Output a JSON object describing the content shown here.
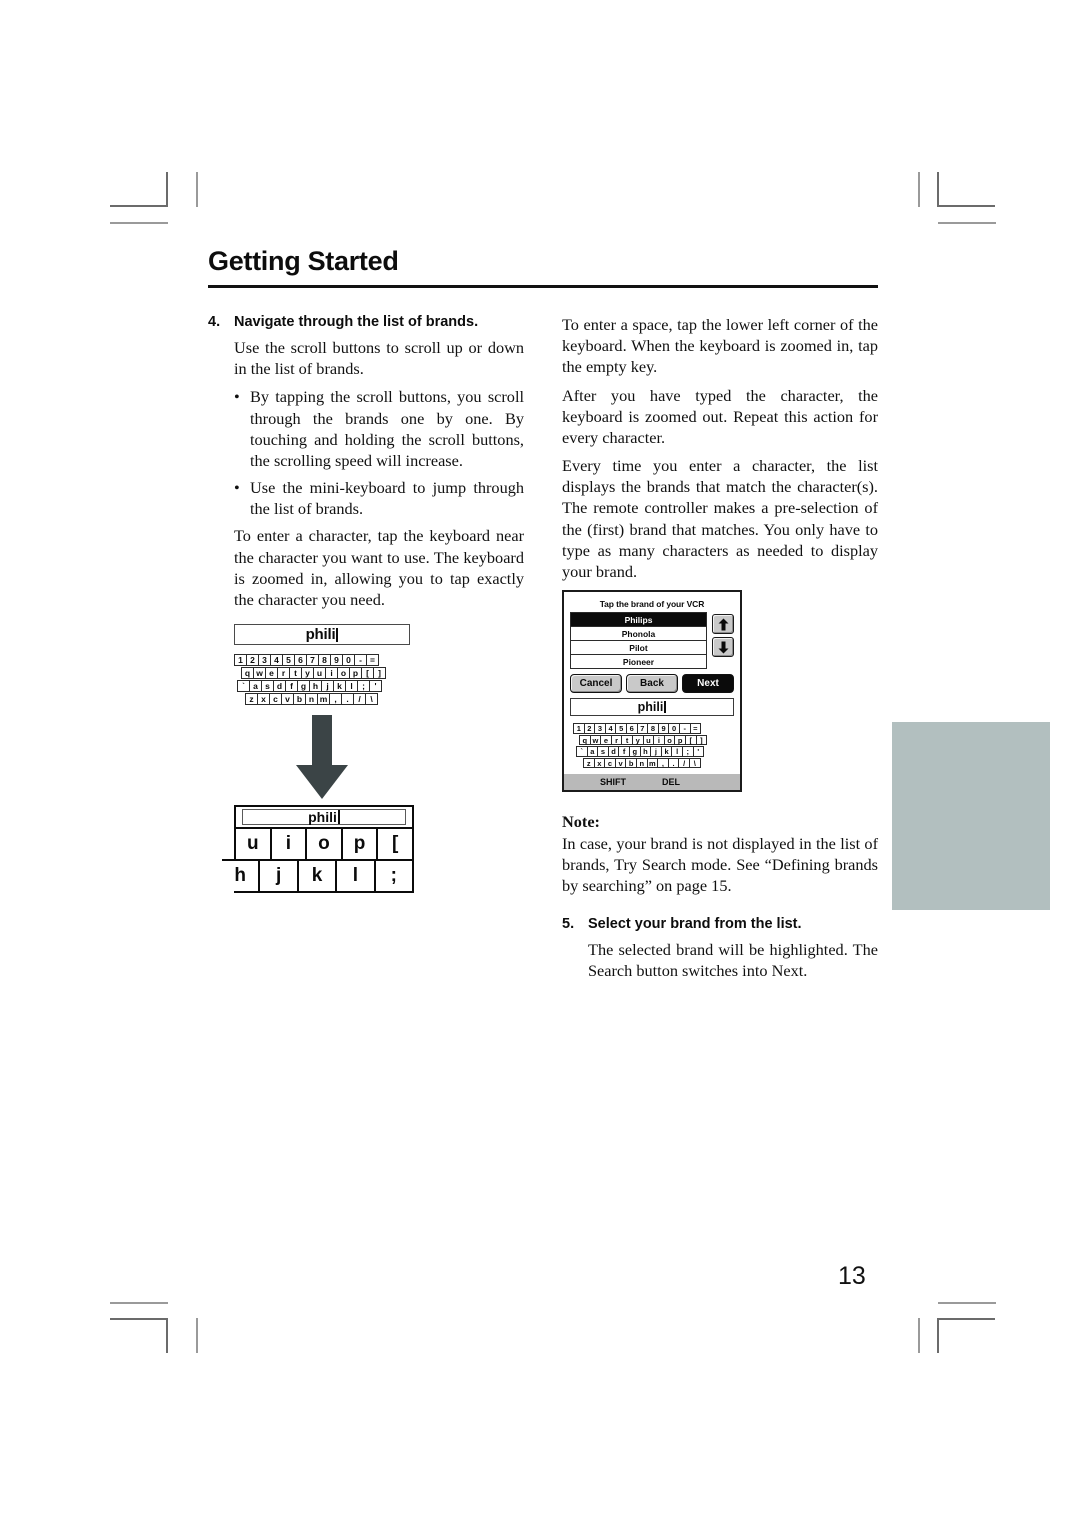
{
  "document": {
    "header_title": "Getting Started",
    "page_number": "13"
  },
  "left_column": {
    "step": {
      "number": "4.",
      "title": "Navigate through the list of brands."
    },
    "intro": "Use the scroll buttons to scroll up or down in the list of brands.",
    "bullet_marker": "•",
    "bullets": [
      "By tapping the scroll buttons, you scroll through the brands one by one. By touching and holding the scroll buttons, the scrolling speed will increase.",
      "Use the mini-keyboard to jump through the list of brands."
    ],
    "closing": "To enter a character, tap the keyboard near the character you want to use. The keyboard is zoomed in, allowing you to tap exactly the character you need."
  },
  "right_column": {
    "paragraphs": [
      "To enter a space, tap the lower left corner of the keyboard. When the keyboard is zoomed in, tap the empty key.",
      "After you have typed the character, the keyboard is zoomed out. Repeat this action for every character.",
      "Every time you enter a character, the list displays the brands that match the character(s). The remote controller makes a pre-selection of the (first) brand that matches. You only have to type as many characters as needed to display your brand."
    ],
    "note": {
      "label": "Note:",
      "text": "In case, your brand is not displayed in the list of brands, Try Search mode. See “Defining brands by searching” on page 15."
    },
    "step": {
      "number": "5.",
      "title": "Select your brand from the list."
    },
    "step_body": "The selected brand will be highlighted. The Search button switches into Next."
  },
  "figure_keyboard": {
    "input_value": "phili",
    "rows": [
      {
        "indent": 0,
        "keys": [
          "1",
          "2",
          "3",
          "4",
          "5",
          "6",
          "7",
          "8",
          "9",
          "0",
          "-",
          "="
        ]
      },
      {
        "indent": 7,
        "keys": [
          "q",
          "w",
          "e",
          "r",
          "t",
          "y",
          "u",
          "i",
          "o",
          "p",
          "[",
          "]"
        ]
      },
      {
        "indent": 3,
        "keys": [
          "`",
          "a",
          "s",
          "d",
          "f",
          "g",
          "h",
          "j",
          "k",
          "l",
          ";",
          "'"
        ]
      },
      {
        "indent": 11,
        "keys": [
          "z",
          "x",
          "c",
          "v",
          "b",
          "n",
          "m",
          ",",
          ".",
          "/",
          "\\"
        ]
      }
    ]
  },
  "figure_zoomed_keyboard": {
    "input_value": "phili",
    "row_top": [
      "u",
      "i",
      "o",
      "p",
      "["
    ],
    "row_bottom": [
      "h",
      "j",
      "k",
      "l",
      ";"
    ]
  },
  "device_screen": {
    "title": "Tap the brand of your VCR",
    "brands": [
      {
        "name": "Philips",
        "selected": true
      },
      {
        "name": "Phonola",
        "selected": false
      },
      {
        "name": "Pilot",
        "selected": false
      },
      {
        "name": "Pioneer",
        "selected": false
      }
    ],
    "scroll_up_icon": "arrow-up-icon",
    "scroll_down_icon": "arrow-down-icon",
    "buttons": [
      {
        "label": "Cancel",
        "inverted": false
      },
      {
        "label": "Back",
        "inverted": false
      },
      {
        "label": "Next",
        "inverted": true
      }
    ],
    "input_value": "phili",
    "bottom_bar": {
      "shift": "SHIFT",
      "del": "DEL"
    }
  },
  "colors": {
    "gray_block": "#b2bfbf",
    "arrow": "#3b4446",
    "crop_mark": "#6b6b6b"
  }
}
